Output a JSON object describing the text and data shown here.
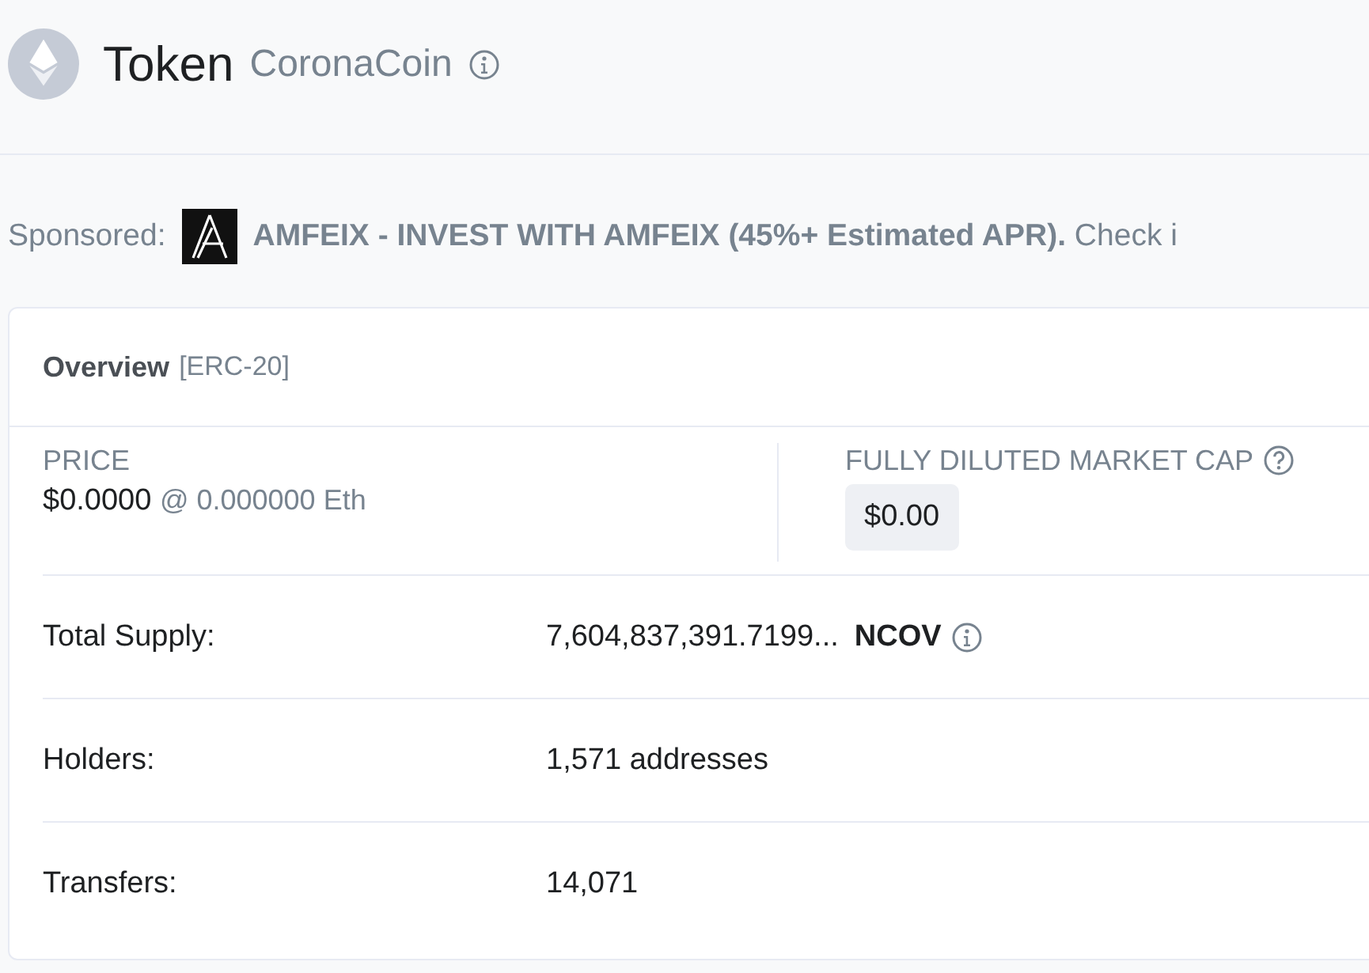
{
  "header": {
    "title": "Token",
    "token_name": "CoronaCoin"
  },
  "sponsored": {
    "label": "Sponsored:",
    "headline": "AMFEIX - INVEST WITH AMFEIX (45%+ Estimated APR).",
    "tail": "Check i"
  },
  "overview": {
    "title": "Overview",
    "standard": "[ERC-20]",
    "price": {
      "label": "PRICE",
      "value": "$0.0000",
      "eth": "@ 0.000000 Eth"
    },
    "market_cap": {
      "label": "FULLY DILUTED MARKET CAP",
      "value": "$0.00"
    },
    "rows": [
      {
        "label": "Total Supply:",
        "value": "7,604,837,391.7199...",
        "unit": "NCOV"
      },
      {
        "label": "Holders:",
        "value": "1,571 addresses"
      },
      {
        "label": "Transfers:",
        "value": "14,071"
      }
    ]
  }
}
